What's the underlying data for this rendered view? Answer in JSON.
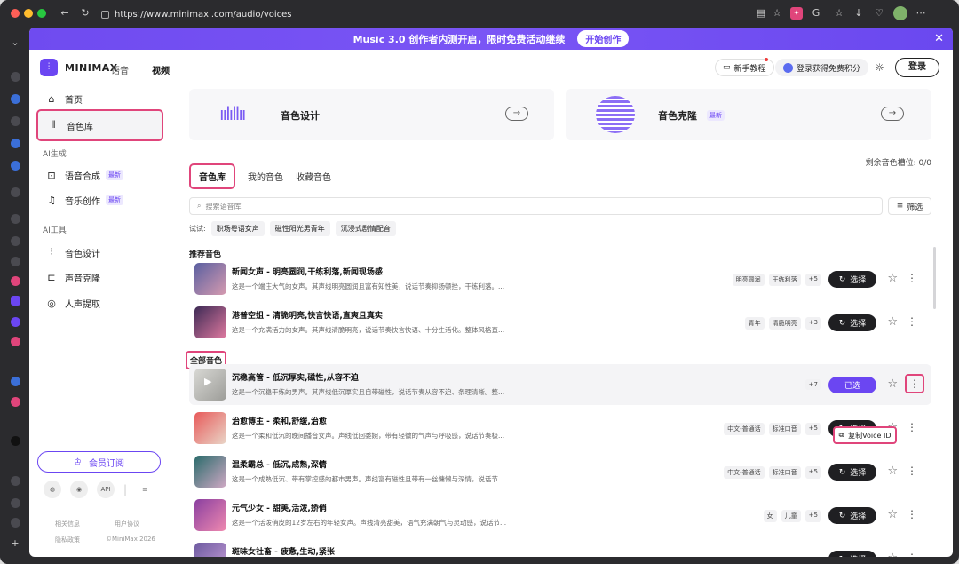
{
  "browser": {
    "url": "https://www.minimaxi.com/audio/voices"
  },
  "banner": {
    "text": "Music 3.0 创作者内测开启，限时免费活动继续",
    "button": "开始创作",
    "close": "✕"
  },
  "header": {
    "brand": "MINIMAX",
    "nav": [
      "语音",
      "视频"
    ],
    "tutorial": "新手教程",
    "credits": "登录获得免费积分",
    "login": "登录"
  },
  "sidebar": {
    "top": [
      {
        "label": "首页",
        "icon": "⌂"
      },
      {
        "label": "音色库",
        "icon": "⫴"
      }
    ],
    "group1": "AI生成",
    "gen": [
      {
        "label": "语音合成",
        "icon": "⊡",
        "tag": "最新"
      },
      {
        "label": "音乐创作",
        "icon": "♫",
        "tag": "最新"
      }
    ],
    "group2": "AI工具",
    "tools": [
      {
        "label": "音色设计",
        "icon": "⫶"
      },
      {
        "label": "声音克隆",
        "icon": "⊏"
      },
      {
        "label": "人声提取",
        "icon": "◎"
      }
    ],
    "vip": "会员订阅",
    "api": "API",
    "footer": [
      "相关信息",
      "用户协议",
      "隐私政策",
      "©MiniMax 2026"
    ]
  },
  "cards": [
    {
      "title": "音色设计"
    },
    {
      "title": "音色克隆",
      "tag": "最新"
    }
  ],
  "slots": "剩余音色槽位:  0/0",
  "tabs": [
    "音色库",
    "我的音色",
    "收藏音色"
  ],
  "search": {
    "placeholder": "搜索语音库",
    "filter": "筛选"
  },
  "try": {
    "label": "试试:",
    "chips": [
      "职场粤语女声",
      "磁性阳光男青年",
      "沉浸式剧情配音"
    ]
  },
  "sections": {
    "recommended": "推荐音色",
    "all": "全部音色"
  },
  "voices": [
    {
      "title": "新闻女声 - 明亮圆润,干练利落,新闻现场感",
      "desc": "这是一个端庄大气的女声。其声线明亮圆润且富有知性美，说话节奏抑扬顿挫，干练利落。...",
      "chips": [
        "明亮圆润",
        "干练利落",
        "+5"
      ],
      "button": "选择",
      "colors": [
        "#5a5fa0",
        "#d79bb0"
      ]
    },
    {
      "title": "港普空姐 - 清脆明亮,快言快语,直爽且真实",
      "desc": "这是一个充满活力的女声。其声线清脆明亮，说话节奏快言快语、十分生活化。整体风格直...",
      "chips": [
        "青年",
        "清脆明亮",
        "+3"
      ],
      "button": "选择",
      "colors": [
        "#3d2a55",
        "#e07aa0"
      ]
    },
    {
      "title": "沉稳高管 - 低沉厚实,磁性,从容不迫",
      "desc": "这是一个沉稳干练的男声。其声线低沉厚实且自带磁性，说话节奏从容不迫、条理清晰。整...",
      "chips": [
        "+7"
      ],
      "button": "已选",
      "colors": [
        "#d8d8d4",
        "#9c9c98"
      ]
    },
    {
      "title": "治愈博主 - 柔和,舒缓,治愈",
      "desc": "这是一个柔和低沉的晚间播音女声。声线低回委婉，带有轻微的气声与呼吸感，说话节奏极...",
      "chips": [
        "中文-普通话",
        "标准口音",
        "+5"
      ],
      "button": "选择",
      "colors": [
        "#e85a5a",
        "#e9d6c8"
      ]
    },
    {
      "title": "温柔霸总 - 低沉,成熟,深情",
      "desc": "这是一个成熟低沉、带有掌控感的都市男声。声线富有磁性且带有一丝慵懒与深情，说话节...",
      "chips": [
        "中文-普通话",
        "标准口音",
        "+5"
      ],
      "button": "选择",
      "colors": [
        "#2a6b6b",
        "#d0a9c5"
      ]
    },
    {
      "title": "元气少女 - 甜美,活泼,娇俏",
      "desc": "这是一个活泼俏皮的12岁左右的年轻女声。声线清亮甜美，语气充满朝气与灵动感，说话节...",
      "chips": [
        "女",
        "儿童",
        "+5"
      ],
      "button": "选择",
      "colors": [
        "#8a3fa0",
        "#f08ab0"
      ]
    },
    {
      "title": "斑味女社畜 - 疲惫,生动,紧张",
      "desc": "",
      "chips": [],
      "button": "选择",
      "colors": [
        "#6d5aa0",
        "#c8a0d8"
      ]
    }
  ],
  "popup": "复制Voice ID"
}
